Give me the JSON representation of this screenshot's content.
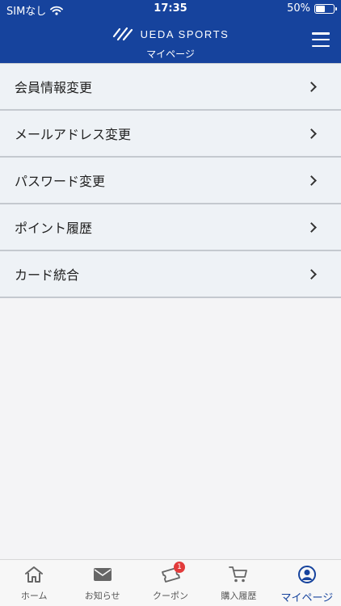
{
  "status_bar": {
    "carrier": "SIMなし",
    "time": "17:35",
    "battery_percent": "50%",
    "battery_level": 0.5
  },
  "header": {
    "brand": "UEDA SPORTS",
    "title": "マイページ",
    "background_color": "#16439d"
  },
  "menu": {
    "items": [
      {
        "label": "会員情報変更"
      },
      {
        "label": "メールアドレス変更"
      },
      {
        "label": "パスワード変更"
      },
      {
        "label": "ポイント履歴"
      },
      {
        "label": "カード統合"
      }
    ]
  },
  "tabbar": {
    "tabs": [
      {
        "label": "ホーム",
        "icon": "home-icon"
      },
      {
        "label": "お知らせ",
        "icon": "mail-icon"
      },
      {
        "label": "クーポン",
        "icon": "ticket-icon",
        "badge": "1"
      },
      {
        "label": "購入履歴",
        "icon": "cart-icon"
      },
      {
        "label": "マイページ",
        "icon": "user-circle-icon",
        "active": true
      }
    ],
    "active_color": "#16439d",
    "badge_color": "#e23b3b"
  }
}
